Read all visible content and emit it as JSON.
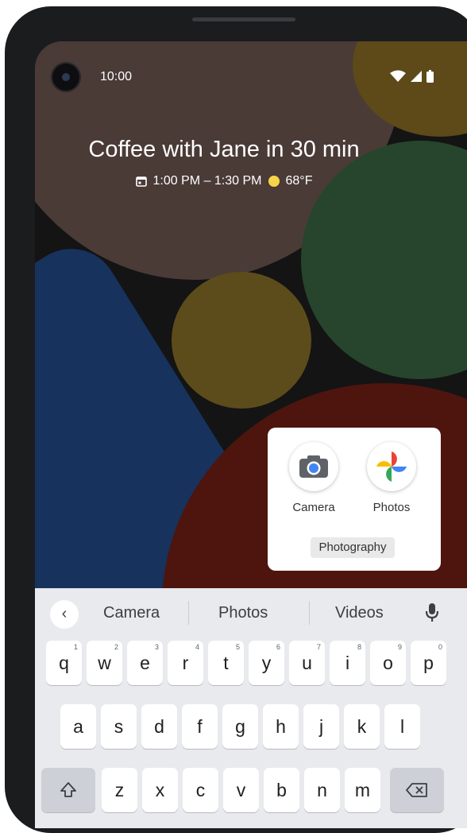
{
  "status_bar": {
    "time": "10:00"
  },
  "glance": {
    "title": "Coffee with Jane in 30 min",
    "time_range": "1:00 PM – 1:30 PM",
    "temperature": "68°F"
  },
  "folder": {
    "name": "Photography",
    "apps": [
      {
        "label": "Camera"
      },
      {
        "label": "Photos"
      }
    ]
  },
  "keyboard": {
    "suggestions": [
      "Camera",
      "Photos",
      "Videos"
    ],
    "rows": [
      [
        {
          "ch": "q",
          "num": "1"
        },
        {
          "ch": "w",
          "num": "2"
        },
        {
          "ch": "e",
          "num": "3"
        },
        {
          "ch": "r",
          "num": "4"
        },
        {
          "ch": "t",
          "num": "5"
        },
        {
          "ch": "y",
          "num": "6"
        },
        {
          "ch": "u",
          "num": "7"
        },
        {
          "ch": "i",
          "num": "8"
        },
        {
          "ch": "o",
          "num": "9"
        },
        {
          "ch": "p",
          "num": "0"
        }
      ],
      [
        {
          "ch": "a"
        },
        {
          "ch": "s"
        },
        {
          "ch": "d"
        },
        {
          "ch": "f"
        },
        {
          "ch": "g"
        },
        {
          "ch": "h"
        },
        {
          "ch": "j"
        },
        {
          "ch": "k"
        },
        {
          "ch": "l"
        }
      ],
      [
        {
          "ch": "z"
        },
        {
          "ch": "x"
        },
        {
          "ch": "c"
        },
        {
          "ch": "v"
        },
        {
          "ch": "b"
        },
        {
          "ch": "n"
        },
        {
          "ch": "m"
        }
      ]
    ]
  },
  "colors": {
    "wallpaper_brown": "#4a3b37",
    "wallpaper_green": "#26452c",
    "wallpaper_navy": "#17325d",
    "wallpaper_red": "#4d150e",
    "wallpaper_gold": "#5d4c1b"
  }
}
